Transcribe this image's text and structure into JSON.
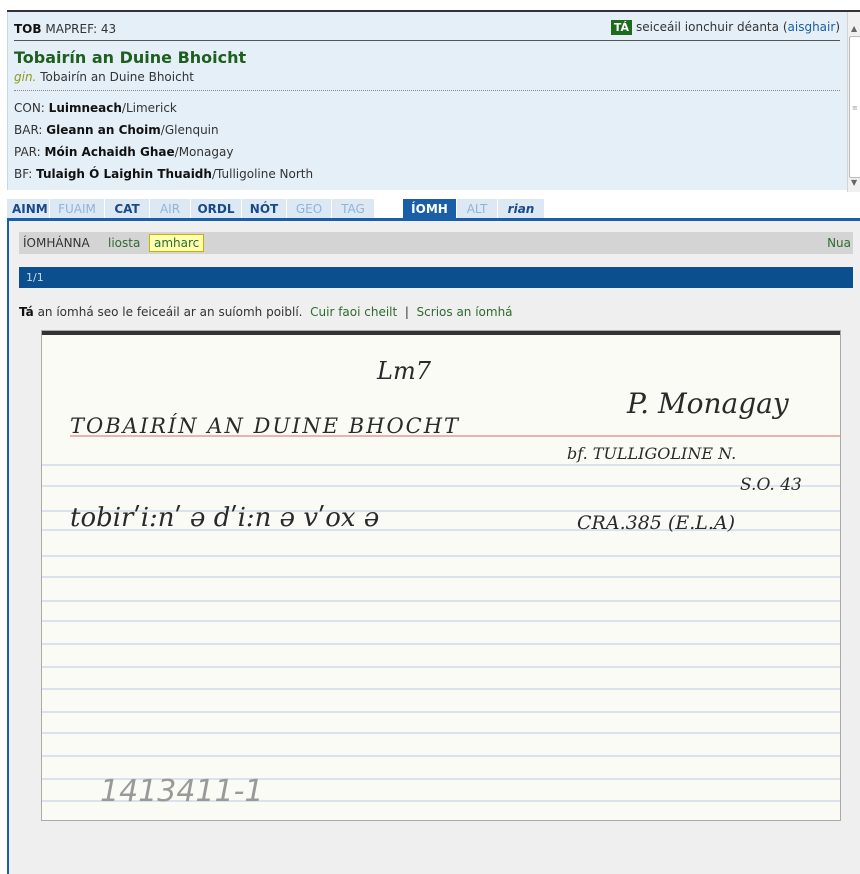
{
  "header": {
    "record_type": "TOB",
    "mapref_label": "MAPREF: 43",
    "status_badge": "TÁ",
    "status_text": "seiceáil ionchuir déanta",
    "undo_open": "(",
    "undo_link": "aisghair",
    "undo_close": ")"
  },
  "place": {
    "name": "Tobairín an Duine Bhoicht",
    "genitive_label": "gin.",
    "genitive_value": "Tobairín an Duine Bhoicht"
  },
  "admin": [
    {
      "code": "CON:",
      "irish": "Luimneach",
      "english": "/Limerick"
    },
    {
      "code": "BAR:",
      "irish": "Gleann an Choim",
      "english": "/Glenquin"
    },
    {
      "code": "PAR:",
      "irish": "Móin Achaidh Ghae",
      "english": "/Monagay"
    },
    {
      "code": "BF:",
      "irish": "Tulaigh Ó Laighin Thuaidh",
      "english": "/Tulligoline North"
    }
  ],
  "tabs": [
    {
      "label": "AINM",
      "state": "active"
    },
    {
      "label": "FUAIM",
      "state": "disabled"
    },
    {
      "label": "CAT",
      "state": "active"
    },
    {
      "label": "AIR",
      "state": "disabled"
    },
    {
      "label": "ORDL",
      "state": "active"
    },
    {
      "label": "NÓT",
      "state": "active"
    },
    {
      "label": "GEO",
      "state": "disabled"
    },
    {
      "label": "TAG",
      "state": "disabled"
    },
    {
      "label": "ÍOMH",
      "state": "current"
    },
    {
      "label": "ALT",
      "state": "disabled"
    },
    {
      "label": "rian",
      "state": "active-italic"
    }
  ],
  "images_bar": {
    "label": "ÍOMHÁNNA",
    "list_link": "liosta",
    "view_link": "amharc",
    "new_link": "Nua"
  },
  "pager": {
    "text": "1/1"
  },
  "visibility": {
    "yes": "Tá",
    "text": "an íomhá seo le feiceáil ar an suíomh poiblí.",
    "hide_link": "Cuir faoi cheilt",
    "separator": "|",
    "delete_link": "Scrios an íomhá"
  },
  "card": {
    "line1": "Lm7",
    "line2": "TOBAIRÍN AN DUINE BHOCHT",
    "line3": "P. Monagay",
    "line4": "bf. TULLIGOLINE N.",
    "line5": "S.O. 43",
    "line6": "tobirʹi:nʹ ə dʹi:n ə vʹox ə",
    "line7": "CRA.385 (E.L.A)",
    "line8": "1413411-1"
  },
  "colors": {
    "panel_bg": "#e5eff7",
    "title_green": "#1e5e1e",
    "accent_blue": "#1a5ea8",
    "pager_blue": "#0c4f8f",
    "badge_green": "#1e6b1e"
  }
}
